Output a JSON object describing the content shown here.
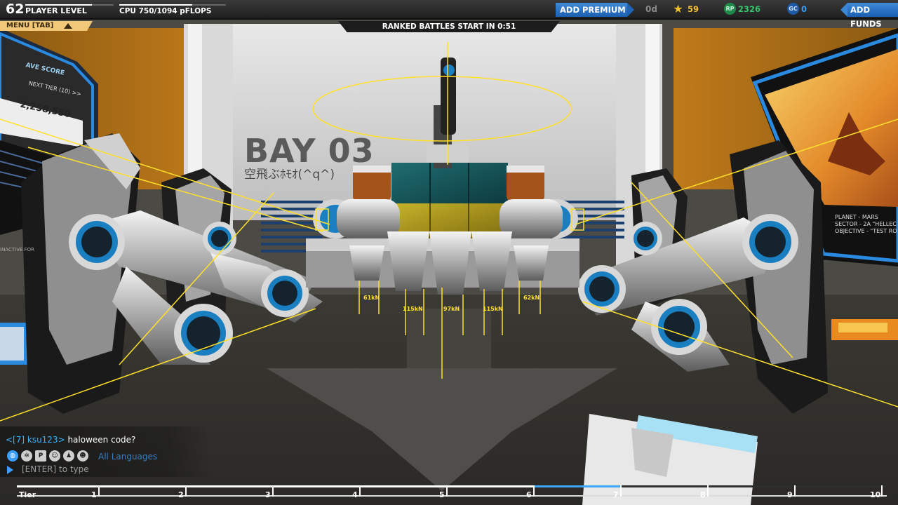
{
  "hud": {
    "player_level": "62",
    "player_level_label": "PLAYER LEVEL",
    "player_level_progress": 0.75,
    "cpu_text": "CPU 750/1094 pFLOPS",
    "cpu_progress": 0.686,
    "add_premium_label": "ADD PREMIUM",
    "premium_days": "0d",
    "stars_icon": "star-icon",
    "stars_value": "59",
    "rp_icon_text": "RP",
    "rp_value": "2326",
    "gc_icon_text": "GC",
    "gc_value": "0",
    "add_funds_label": "ADD FUNDS",
    "menu_label": "MENU [TAB]",
    "countdown": "RANKED BATTLES START IN 0:51"
  },
  "scene": {
    "bay_title": "BAY 03",
    "bay_subtitle": "空飛ぶﾎﾓｵ(^q^)",
    "left_screen_avg": "AVE SCORE",
    "left_screen_next": "NEXT TIER (10) >>",
    "left_screen_score": "2,258,550",
    "inactive_label": "INACTIVE FOR",
    "planet_line": "PLANET - MARS",
    "sector_line": "SECTOR - 2A \"HELLEC",
    "objective_line": "OBJECTIVE - \"TEST RO",
    "force_labels": [
      "61kN",
      "115kN",
      "97kN",
      "115kN",
      "62kN"
    ]
  },
  "chat": {
    "user": "<[7] ksu123>",
    "message": " haloween code?",
    "icons": [
      "globe-icon",
      "compass-icon",
      "p-icon",
      "person-icon",
      "party-icon",
      "group-icon"
    ],
    "language": "All Languages",
    "prompt": "[ENTER] to type"
  },
  "tierbar": {
    "label": "Tier",
    "tiers": [
      "1",
      "2",
      "3",
      "4",
      "5",
      "6",
      "7",
      "8",
      "9",
      "10"
    ],
    "current_tier": "6"
  },
  "colors": {
    "accent_blue": "#2f7fd0",
    "thrust_yellow": "#ffe02a",
    "menu_tab": "#f0c878",
    "chat_user": "#3ab3ff"
  }
}
